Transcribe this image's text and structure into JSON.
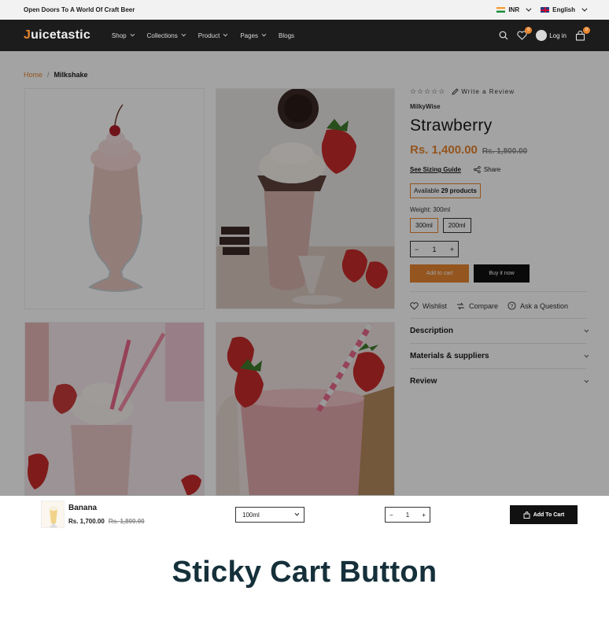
{
  "topbar": {
    "announcement": "Open Doors To A World Of Craft Beer",
    "currency": "INR",
    "language": "English"
  },
  "header": {
    "logo_first": "J",
    "logo_rest": "uicetastic",
    "nav": [
      "Shop",
      "Collections",
      "Product",
      "Pages",
      "Blogs"
    ],
    "wishlist_count": "0",
    "login_label": "Log in",
    "cart_count": "0"
  },
  "breadcrumb": {
    "home": "Home",
    "separator": "/",
    "current": "Milkshake"
  },
  "product": {
    "stars": "☆☆☆☆☆",
    "write_review": "Write a Review",
    "vendor": "MilkyWise",
    "title": "Strawberry",
    "price": "Rs. 1,400.00",
    "compare_price": "Rs. 1,800.00",
    "sizing_guide": "See Sizing Guide",
    "share": "Share",
    "availability_prefix": "Available",
    "availability_count": "29 products",
    "weight_label": "Weight: 300ml",
    "variants": [
      "300ml",
      "200ml"
    ],
    "quantity": "1",
    "add_to_cart": "Add to cart",
    "buy_now": "Buy it now",
    "actions": [
      "Wishlist",
      "Compare",
      "Ask a Question"
    ],
    "accordions": [
      "Description",
      "Materials & suppliers",
      "Review"
    ]
  },
  "sticky": {
    "name": "Banana",
    "price": "Rs. 1,700.00",
    "compare_price": "Rs. 1,800.00",
    "variant": "100ml",
    "quantity": "1",
    "button": "Add To Cart"
  },
  "caption": "Sticky Cart Button",
  "colors": {
    "accent": "#e8862f",
    "header_bg": "#1c1c1c",
    "caption": "#15303a"
  }
}
